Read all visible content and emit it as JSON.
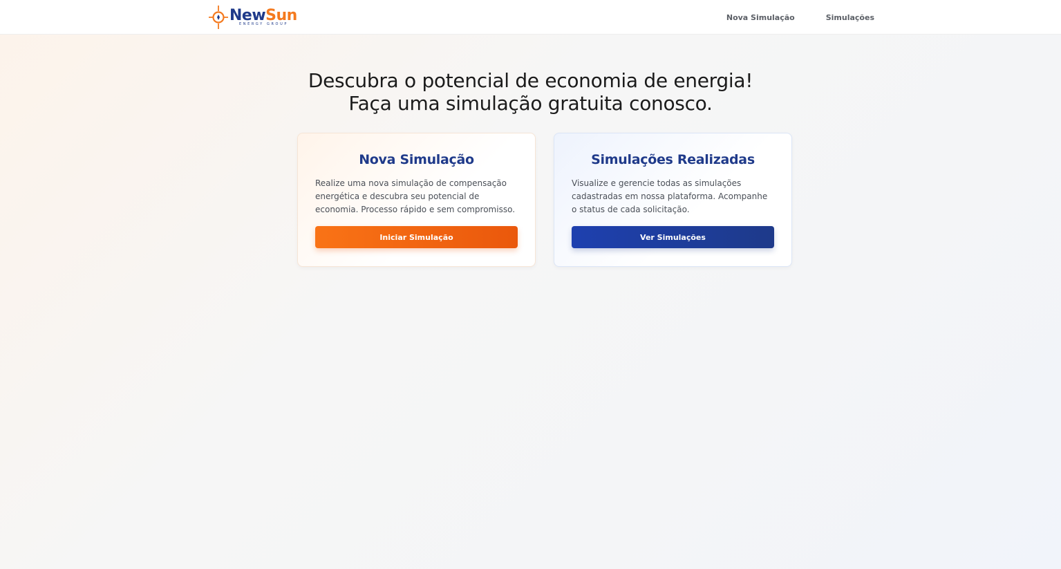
{
  "header": {
    "logo": {
      "word_new": "New",
      "word_sun": "Sun",
      "subtitle": "ENERGY GROUP"
    },
    "nav": [
      {
        "label": "Nova Simulação"
      },
      {
        "label": "Simulações"
      }
    ]
  },
  "hero": {
    "line1": "Descubra o potencial de economia de energia!",
    "line2": "Faça uma simulação gratuita conosco."
  },
  "cards": [
    {
      "title": "Nova Simulação",
      "description": "Realize uma nova simulação de compensação energética e descubra seu potencial de economia. Processo rápido e sem compromisso.",
      "button": "Iniciar Simulação"
    },
    {
      "title": "Simulações Realizadas",
      "description": "Visualize e gerencie todas as simulações cadastradas em nossa plataforma. Acompanhe o status de cada solicitação.",
      "button": "Ver Simulações"
    }
  ],
  "colors": {
    "brand_blue": "#1f3a8a",
    "brand_orange": "#f47a1f"
  },
  "icons": {
    "logo": "sun-compass-icon"
  }
}
